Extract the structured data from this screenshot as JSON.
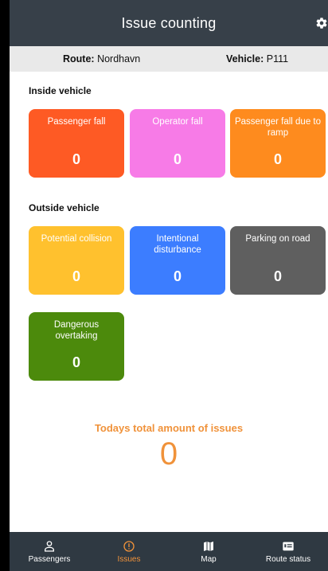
{
  "header": {
    "title": "Issue counting",
    "settings_icon": "gear-icon"
  },
  "info": {
    "route_label": "Route:",
    "route_value": "Nordhavn",
    "vehicle_label": "Vehicle:",
    "vehicle_value": "P111"
  },
  "inside": {
    "title": "Inside vehicle",
    "tiles": [
      {
        "label": "Passenger fall",
        "count": "0",
        "color": "#fe5a24"
      },
      {
        "label": "Operator fall",
        "count": "0",
        "color": "#f77be7"
      },
      {
        "label": "Passenger fall due to ramp",
        "count": "0",
        "color": "#fe8b1e"
      }
    ]
  },
  "outside": {
    "title": "Outside vehicle",
    "tiles": [
      {
        "label": "Potential collision",
        "count": "0",
        "color": "#ffc12e"
      },
      {
        "label": "Intentional disturbance",
        "count": "0",
        "color": "#3c7dff"
      },
      {
        "label": "Parking on road",
        "count": "0",
        "color": "#5f5f5f"
      },
      {
        "label": "Dangerous overtaking",
        "count": "0",
        "color": "#4c8a0c"
      }
    ]
  },
  "total": {
    "label": "Todays total amount of issues",
    "value": "0",
    "color": "#f0923a"
  },
  "nav": {
    "items": [
      {
        "label": "Passengers",
        "icon": "person-icon",
        "active": false
      },
      {
        "label": "Issues",
        "icon": "alert-circle-icon",
        "active": true
      },
      {
        "label": "Map",
        "icon": "map-icon",
        "active": false
      },
      {
        "label": "Route status",
        "icon": "list-card-icon",
        "active": false
      }
    ]
  }
}
